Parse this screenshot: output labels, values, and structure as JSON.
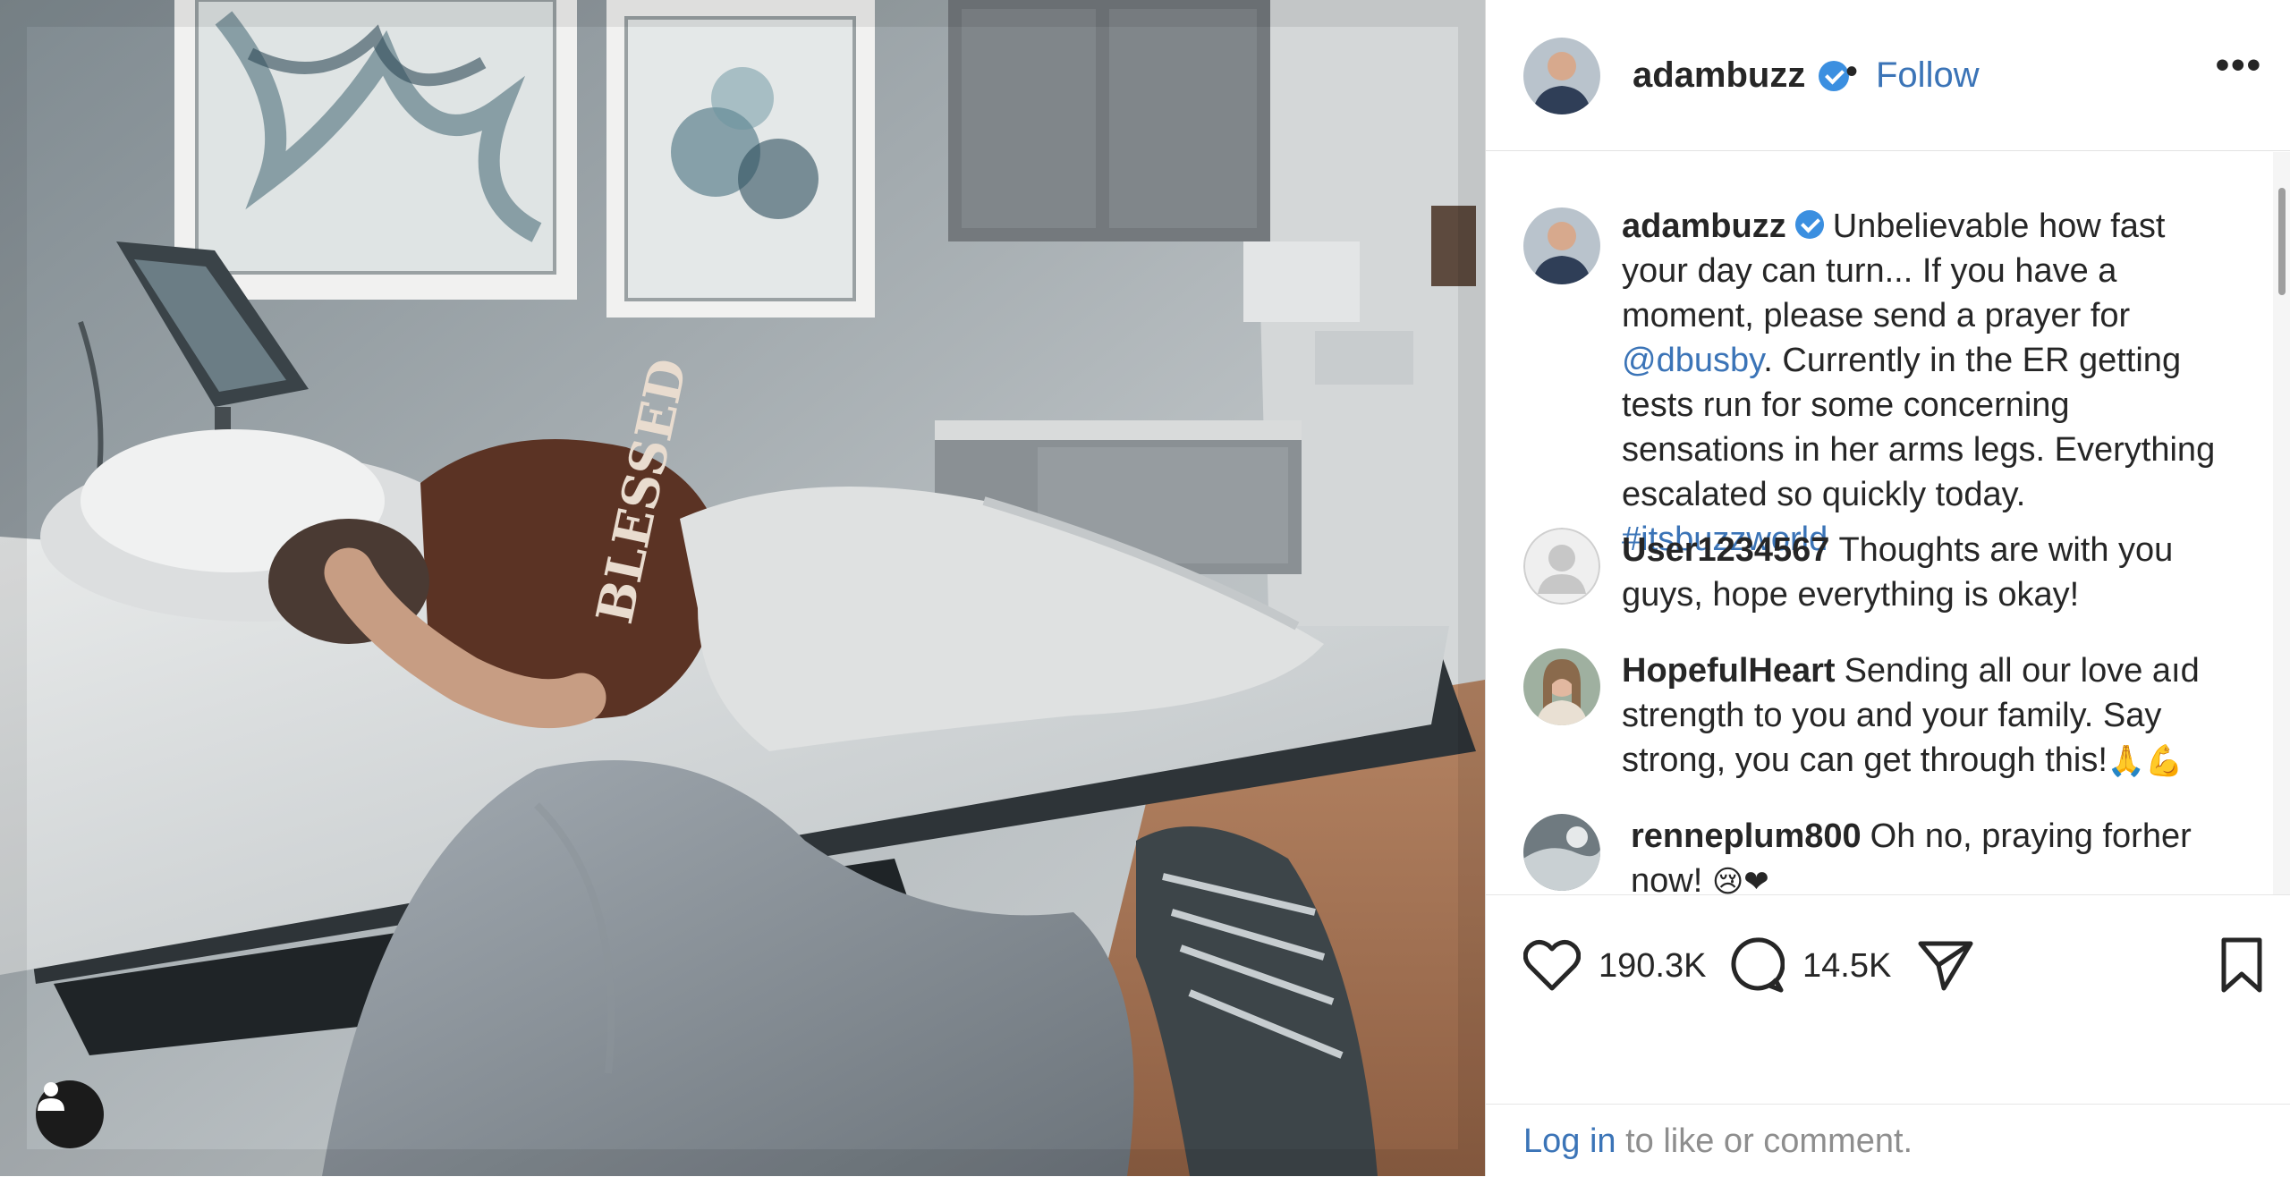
{
  "post": {
    "author": "adambuzz",
    "follow_label": "Follow",
    "separator": "•",
    "more_label": "•••"
  },
  "caption": {
    "username": "adambuzz",
    "text_before_mention": "Unbelievable how fast your day can turn... If you have a moment, please send a prayer for",
    "mention": "@dbusby",
    "text_after_mention": ". Currently in the ER getting tests run for some concerning sensations in her arms legs. Everything escalated so quickly today.",
    "hashtag": "#itsbuzzworld"
  },
  "comments": [
    {
      "username": "User1234567",
      "text": "Thoughts are with you guys, hope everything is okay!"
    },
    {
      "username": "HopefulHeart",
      "text": "Sending all our love aıd strength to you and your family. Say strong, you can get through this!",
      "emoji": "🙏💪"
    },
    {
      "username": "renneplum800",
      "text": "Oh no, praying forher now!",
      "emoji": "😢❤"
    }
  ],
  "stats": {
    "likes": "190.3K",
    "comments": "14.5K"
  },
  "login": {
    "link": "Log in",
    "text": "to like or comment."
  },
  "photo": {
    "shirt_text": "BLESSED"
  },
  "icons": {
    "verified": "verified-badge-icon",
    "like": "heart-icon",
    "comment": "comment-bubble-icon",
    "share": "paper-plane-icon",
    "save": "bookmark-icon",
    "tags": "user-tag-icon"
  },
  "colors": {
    "link": "#3b74b7",
    "verified": "#3b8fe0",
    "text": "#262626",
    "muted": "#8e8e8e",
    "heart": "#d32f2f"
  }
}
